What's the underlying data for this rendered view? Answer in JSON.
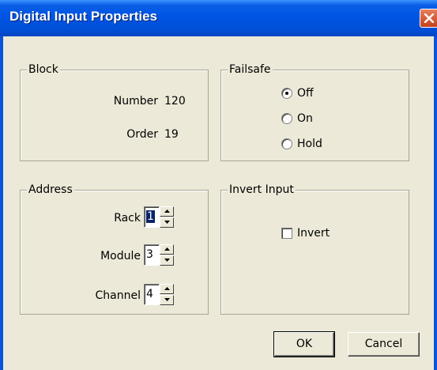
{
  "window": {
    "title": "Digital Input Properties",
    "close_icon": "close-icon"
  },
  "block": {
    "legend": "Block",
    "number_label": "Number",
    "number_value": "120",
    "order_label": "Order",
    "order_value": "19"
  },
  "failsafe": {
    "legend": "Failsafe",
    "options": [
      {
        "label": "Off",
        "selected": true
      },
      {
        "label": "On",
        "selected": false
      },
      {
        "label": "Hold",
        "selected": false
      }
    ]
  },
  "address": {
    "legend": "Address",
    "rack_label": "Rack",
    "rack_value": "1",
    "module_label": "Module",
    "module_value": "3",
    "channel_label": "Channel",
    "channel_value": "4"
  },
  "invert_input": {
    "legend": "Invert Input",
    "checkbox_label": "Invert",
    "checked": false
  },
  "buttons": {
    "ok_label": "OK",
    "cancel_label": "Cancel"
  },
  "colors": {
    "titlebar": "#0054e3",
    "dialog_bg": "#ece9d8",
    "selection": "#0a246a"
  }
}
